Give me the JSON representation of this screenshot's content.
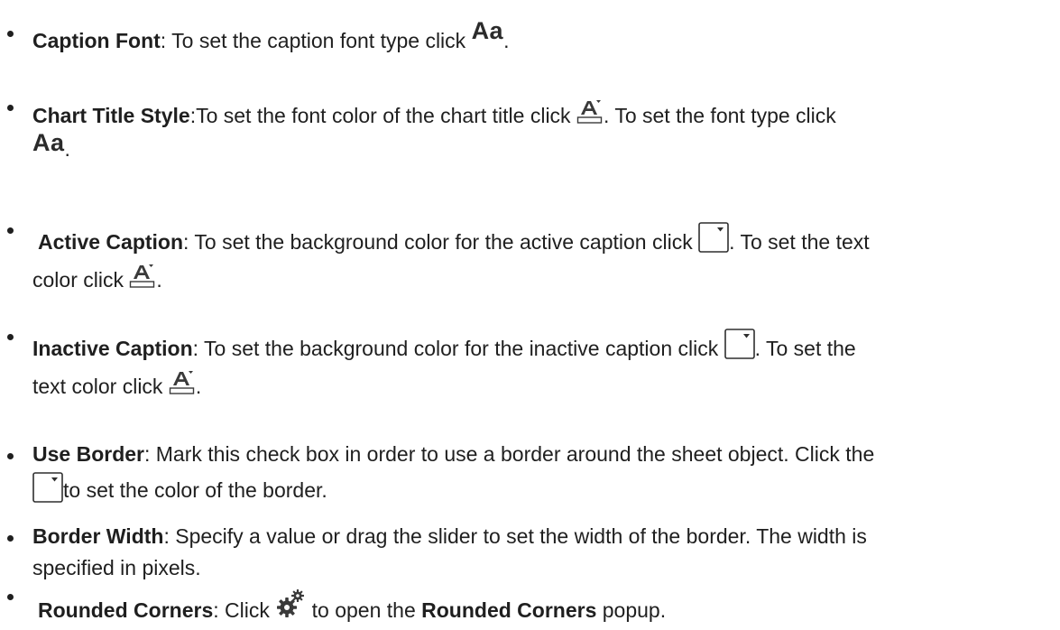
{
  "items": [
    {
      "term": "Caption Font",
      "text1": ": To set the caption font type click",
      "text2": "."
    },
    {
      "term": "Chart Title Style",
      "text1": ":To set the font color of the chart title click",
      "text2": ". To set the font type click",
      "text3": "."
    },
    {
      "term": "Active Caption",
      "text1": ": To set the background color for the active caption click",
      "text2": ". To set the text",
      "text3": "color click",
      "text4": "."
    },
    {
      "term": "Inactive Caption",
      "text1": ": To set the background color for the inactive caption click",
      "text2": ". To set the",
      "text3": "text color click",
      "text4": "."
    },
    {
      "term": "Use Border",
      "text1": ": Mark this check box in order to use a border around the sheet object. Click the",
      "text2": "to set the color of the border."
    },
    {
      "term": "Border Width",
      "text1": ": Specify a value or drag the slider to set the width of the border. The width is",
      "text2": "specified in pixels."
    },
    {
      "term": "Rounded Corners",
      "text1": ": Click",
      "text2": "to open the",
      "term2": "Rounded Corners",
      "text3": "popup."
    }
  ],
  "icons": {
    "font_type_glyph": "Aa"
  }
}
